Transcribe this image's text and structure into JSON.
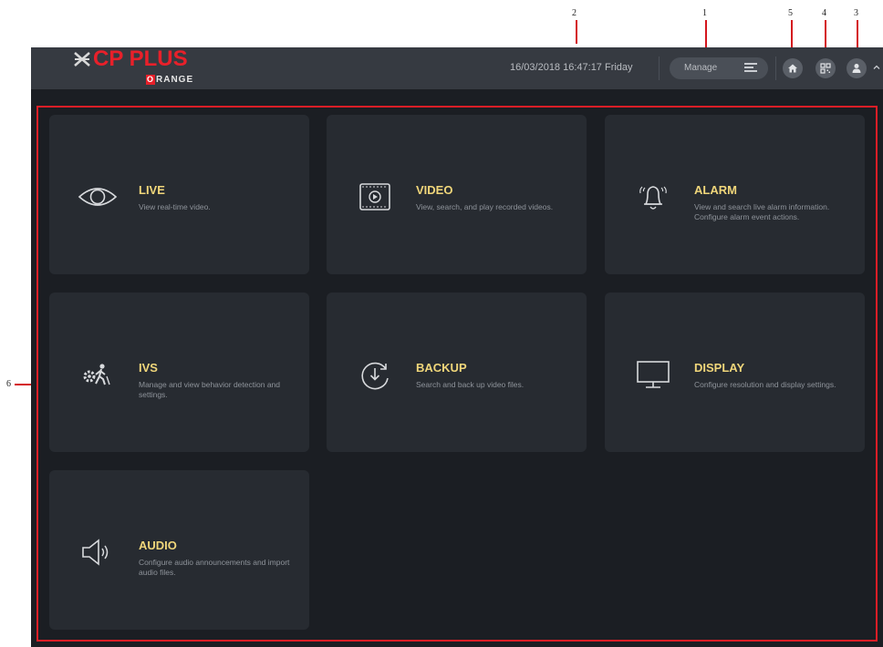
{
  "header": {
    "logo_main": "CP PLUS",
    "logo_sub_initial": "O",
    "logo_sub_rest": "RANGE",
    "datetime": "16/03/2018 16:47:17 Friday",
    "manage_label": "Manage"
  },
  "header_icons": [
    "home-icon",
    "qr-code-icon",
    "user-icon",
    "chevron-down-icon"
  ],
  "annotations": [
    "1",
    "2",
    "3",
    "4",
    "5",
    "6"
  ],
  "tiles": [
    {
      "title": "LIVE",
      "desc": "View real-time video."
    },
    {
      "title": "VIDEO",
      "desc": "View, search, and play recorded videos."
    },
    {
      "title": "ALARM",
      "desc": "View and search live alarm information. Configure alarm event actions."
    },
    {
      "title": "IVS",
      "desc": "Manage and view behavior detection and settings."
    },
    {
      "title": "BACKUP",
      "desc": "Search and back up video files."
    },
    {
      "title": "DISPLAY",
      "desc": "Configure resolution and display settings."
    },
    {
      "title": "AUDIO",
      "desc": "Configure audio announcements and import audio files."
    }
  ],
  "colors": {
    "accent_red": "#e01e26",
    "tile_title": "#f0d67a",
    "background": "#1b1e23",
    "topbar": "#363a41"
  }
}
